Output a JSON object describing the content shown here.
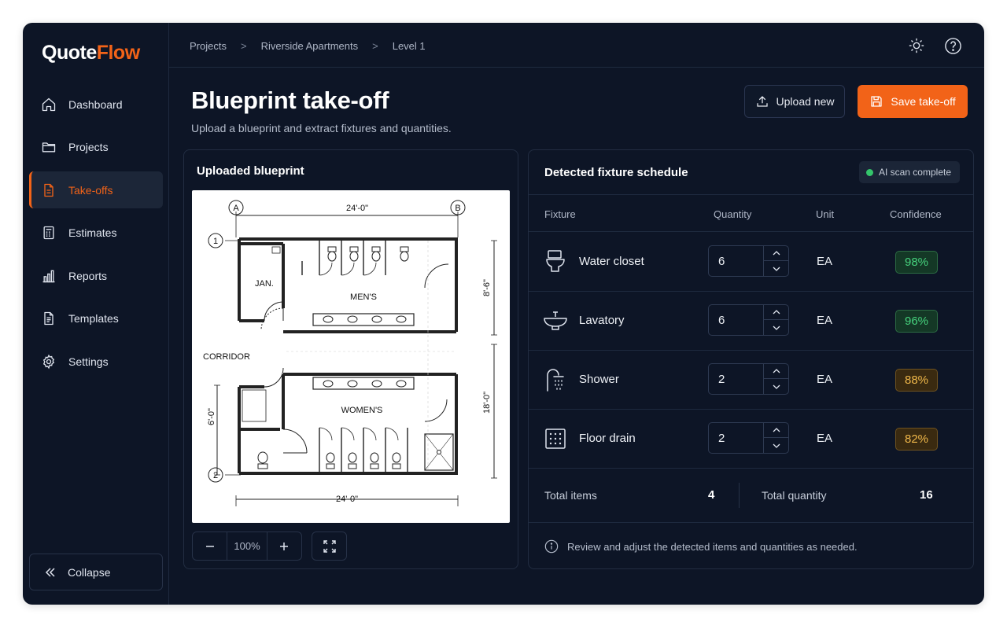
{
  "app": {
    "logo_part1": "Quote",
    "logo_part2": "Flow",
    "accent_color": "#f26318"
  },
  "sidebar": {
    "items": [
      {
        "label": "Dashboard",
        "icon": "home-icon"
      },
      {
        "label": "Projects",
        "icon": "folder-icon"
      },
      {
        "label": "Take-offs",
        "icon": "document-icon",
        "active": true
      },
      {
        "label": "Estimates",
        "icon": "calculator-icon"
      },
      {
        "label": "Reports",
        "icon": "bar-chart-icon"
      },
      {
        "label": "Templates",
        "icon": "template-icon"
      },
      {
        "label": "Settings",
        "icon": "gear-icon"
      }
    ],
    "collapse_label": "Collapse"
  },
  "breadcrumb": [
    "Projects",
    "Riverside Apartments",
    "Level 1"
  ],
  "header": {
    "title": "Blueprint take-off",
    "subtitle": "Upload a blueprint and extract fixtures and quantities.",
    "upload_label": "Upload new",
    "save_label": "Save take-off"
  },
  "blueprint_panel": {
    "title": "Uploaded blueprint",
    "zoom_value": "100%",
    "drawing": {
      "grid_a": "A",
      "grid_b": "B",
      "grid_1": "1",
      "grid_2": "2",
      "dim_top": "24'-0\"",
      "dim_bottom": "24'-0\"",
      "dim_right_top": "8'-6\"",
      "dim_right_bottom": "18'-0\"",
      "dim_left": "6'-0\"",
      "room_jan": "JAN.",
      "room_mens": "MEN'S",
      "room_womens": "WOMEN'S",
      "room_corridor": "CORRIDOR"
    }
  },
  "schedule": {
    "title": "Detected fixture schedule",
    "badge": "AI scan complete",
    "columns": [
      "Fixture",
      "Quantity",
      "Unit",
      "Confidence"
    ],
    "rows": [
      {
        "fixture": "Water closet",
        "icon": "toilet-icon",
        "quantity": "6",
        "unit": "EA",
        "confidence": "98%",
        "level": "high"
      },
      {
        "fixture": "Lavatory",
        "icon": "sink-icon",
        "quantity": "6",
        "unit": "EA",
        "confidence": "96%",
        "level": "high"
      },
      {
        "fixture": "Shower",
        "icon": "shower-icon",
        "quantity": "2",
        "unit": "EA",
        "confidence": "88%",
        "level": "medium"
      },
      {
        "fixture": "Floor drain",
        "icon": "floor-drain-icon",
        "quantity": "2",
        "unit": "EA",
        "confidence": "82%",
        "level": "medium"
      }
    ],
    "total_items_label": "Total items",
    "total_items_value": "4",
    "total_quantity_label": "Total quantity",
    "total_quantity_value": "16",
    "note": "Review and adjust the detected items and quantities as needed.",
    "colors": {
      "high": "#46d27d",
      "medium": "#f0b84a"
    }
  }
}
